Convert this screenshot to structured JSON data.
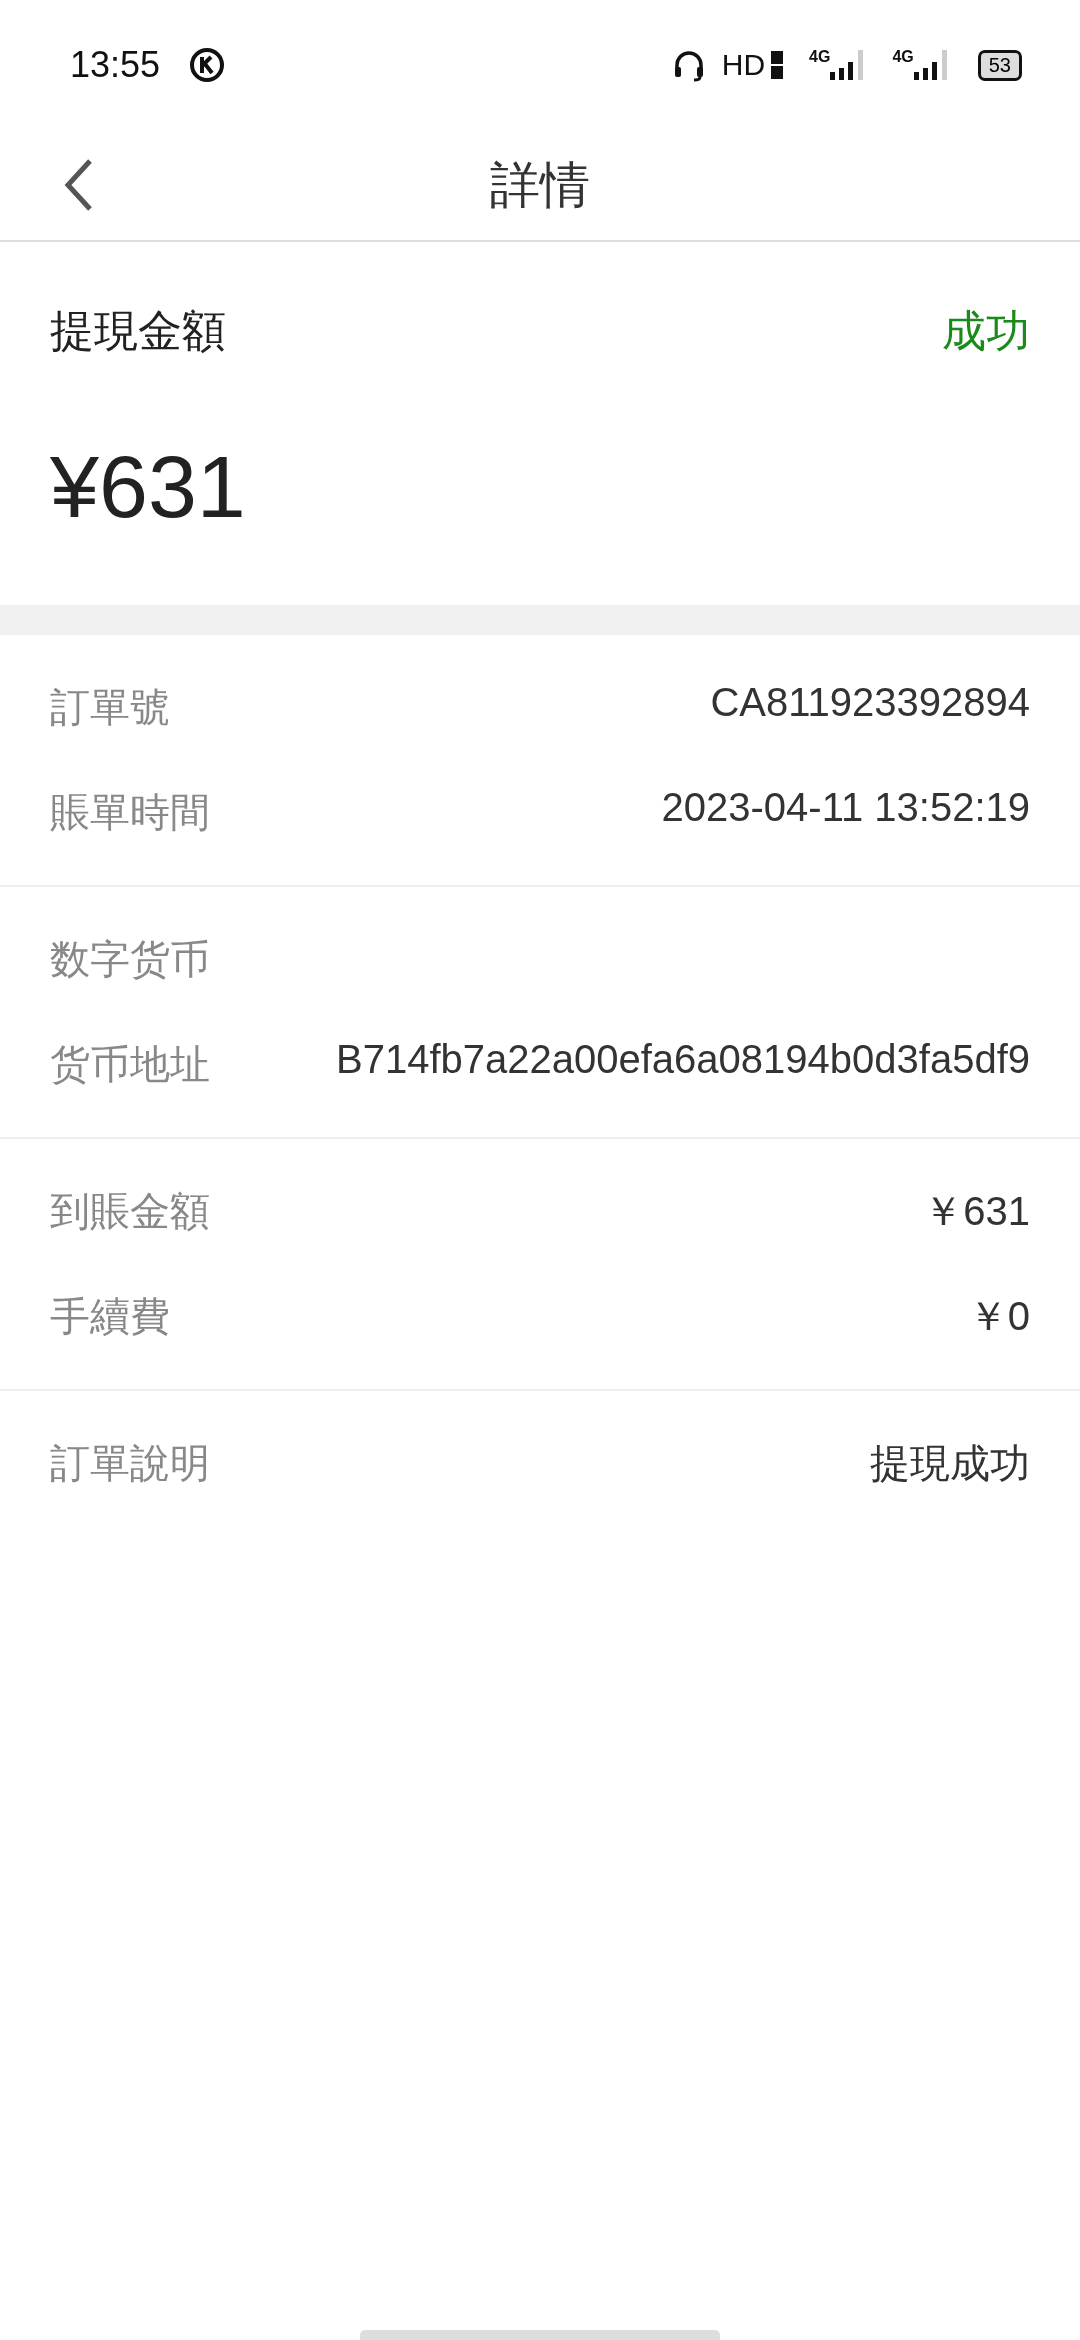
{
  "status_bar": {
    "time": "13:55",
    "network": "HD",
    "signals": [
      {
        "label": "4G"
      },
      {
        "label": "4G"
      }
    ],
    "battery": "53"
  },
  "nav": {
    "title": "詳情"
  },
  "summary": {
    "label": "提現金額",
    "status": "成功",
    "amount": "¥631"
  },
  "groups": [
    {
      "rows": [
        {
          "label": "訂單號",
          "value": "CA811923392894"
        },
        {
          "label": "賬單時間",
          "value": "2023-04-11 13:52:19"
        }
      ]
    },
    {
      "rows": [
        {
          "label": "数字货币"
        },
        {
          "label": "货币地址",
          "value": "B714fb7a22a00efa6a08194b0d3fa5df9"
        }
      ]
    },
    {
      "rows": [
        {
          "label": "到賬金額",
          "value": "￥631"
        },
        {
          "label": "手續費",
          "value": "￥0"
        }
      ]
    },
    {
      "rows": [
        {
          "label": "訂單說明",
          "value": "提現成功"
        }
      ]
    }
  ]
}
